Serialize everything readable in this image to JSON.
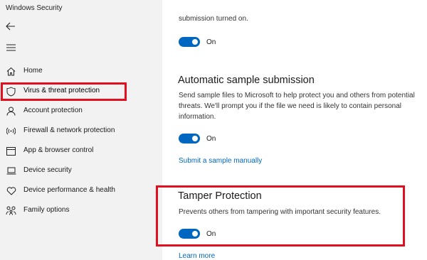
{
  "app": {
    "title": "Windows Security"
  },
  "sidebar": {
    "items": [
      {
        "label": "Home",
        "icon": "home-icon"
      },
      {
        "label": "Virus & threat protection",
        "icon": "shield-icon"
      },
      {
        "label": "Account protection",
        "icon": "person-icon"
      },
      {
        "label": "Firewall & network protection",
        "icon": "wifi-signal-icon"
      },
      {
        "label": "App & browser control",
        "icon": "browser-window-icon"
      },
      {
        "label": "Device security",
        "icon": "laptop-icon"
      },
      {
        "label": "Device performance & health",
        "icon": "heart-icon"
      },
      {
        "label": "Family options",
        "icon": "family-icon"
      }
    ],
    "active_index": 1
  },
  "main": {
    "top_partial_text": "submission turned on.",
    "toggle1": {
      "state_label": "On"
    },
    "auto_sample": {
      "title": "Automatic sample submission",
      "description": "Send sample files to Microsoft to help protect you and others from potential threats. We'll prompt you if the file we need is likely to contain personal information.",
      "toggle_label": "On",
      "link": "Submit a sample manually"
    },
    "tamper": {
      "title": "Tamper Protection",
      "description": "Prevents others from tampering with important security features.",
      "toggle_label": "On",
      "link": "Learn more"
    }
  },
  "colors": {
    "accent": "#0067c0",
    "highlight": "#e0101e",
    "sidebar_bg": "#f2f2f2"
  }
}
